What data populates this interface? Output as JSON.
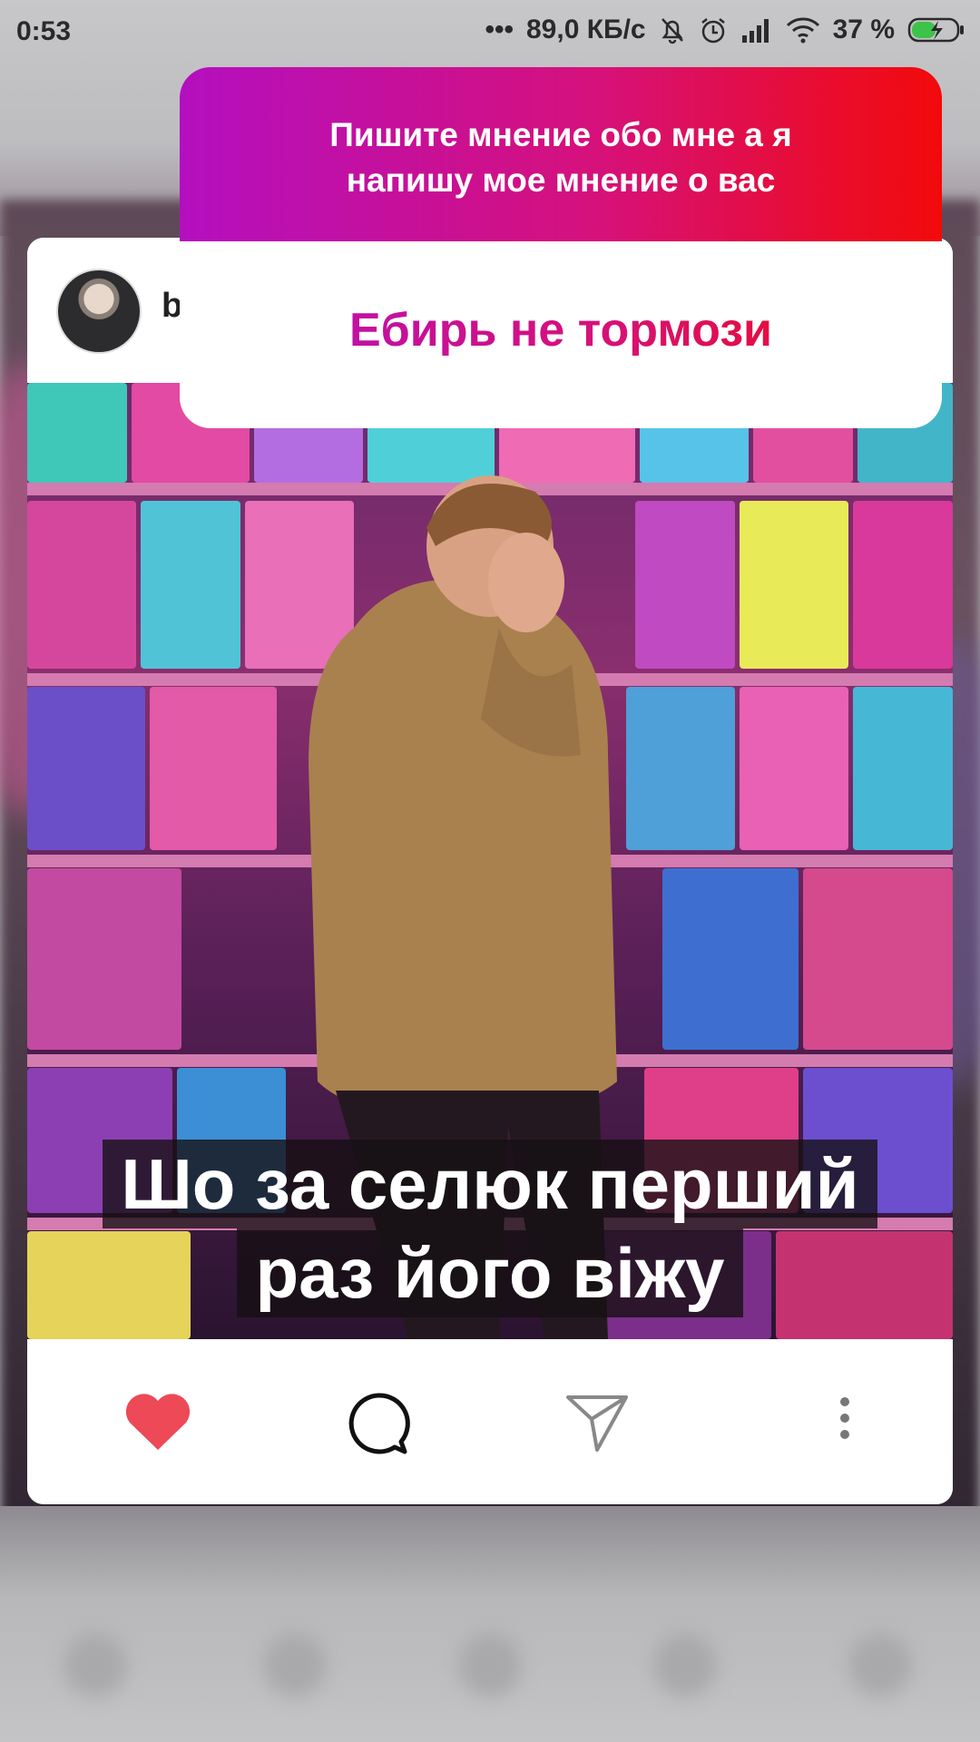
{
  "status_bar": {
    "time": "0:53",
    "dots": "•••",
    "speed": "89,0 КБ/с",
    "battery": "37 %",
    "icons": [
      "bell-off-icon",
      "alarm-icon",
      "signal-icon",
      "wifi-icon",
      "battery-charging-icon"
    ]
  },
  "post": {
    "username": "b",
    "caption_line1": "Шо за селюк перший",
    "caption_line2": "раз його віжу",
    "actions": [
      "heart-icon",
      "comment-icon",
      "share-icon",
      "more-icon"
    ],
    "liked": true,
    "like_color": "#ed4956"
  },
  "question_sticker": {
    "question": "Пишите мнение обо мне а я",
    "question_line2": "напишу мое мнение о вас",
    "answer": "Ебирь не тормози",
    "gradient": [
      "#b40fbf",
      "#d6117a",
      "#f20a0a"
    ]
  }
}
